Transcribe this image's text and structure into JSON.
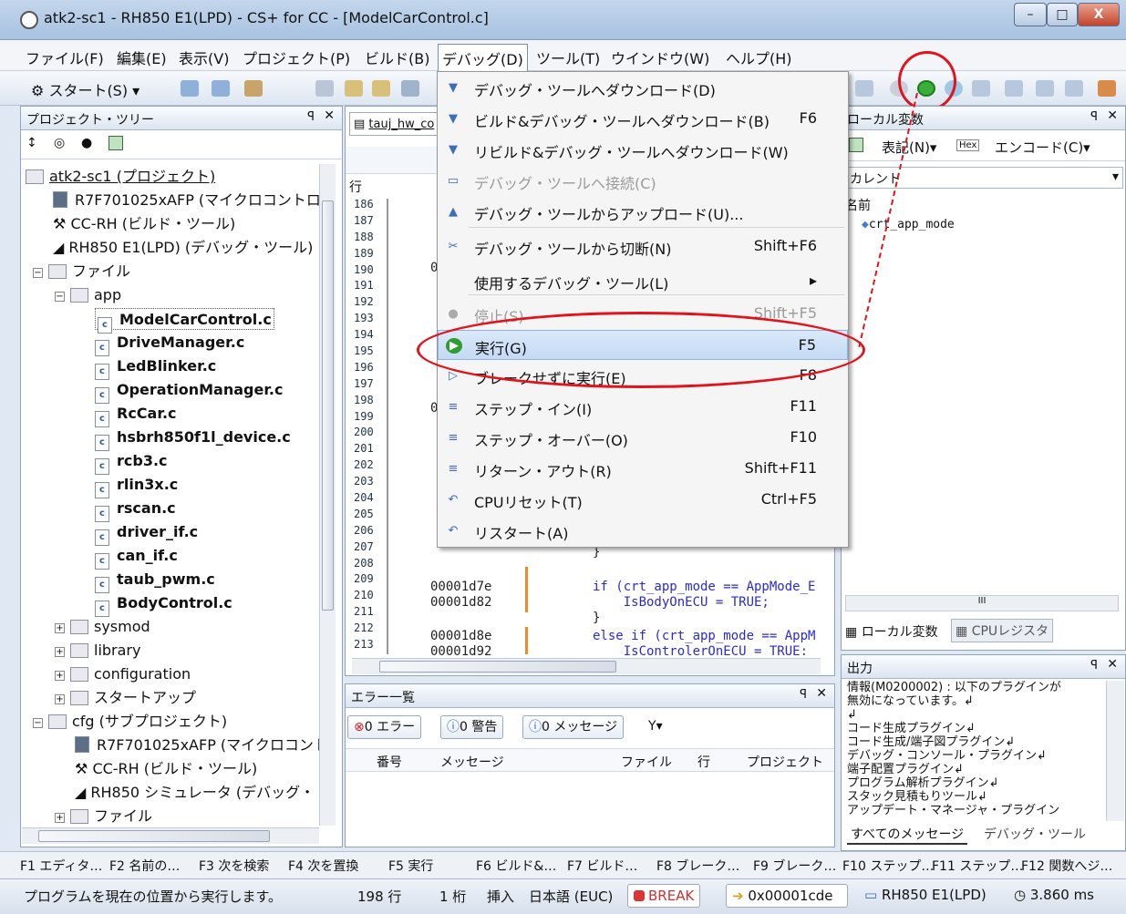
{
  "window": {
    "title": "atk2-sc1 - RH850 E1(LPD) - CS+ for CC - [ModelCarControl.c]",
    "min": "–",
    "max": "□",
    "close": "X"
  },
  "menubar": [
    "ファイル(F)",
    "編集(E)",
    "表示(V)",
    "プロジェクト(P)",
    "ビルド(B)",
    "デバッグ(D)",
    "ツール(T)",
    "ウインドウ(W)",
    "ヘルプ(H)"
  ],
  "toolbar": {
    "start": "スタート(S)"
  },
  "tree": {
    "title": "プロジェクト・ツリー",
    "pin": "ꟼ",
    "close": "✕",
    "project": "atk2-sc1 (プロジェクト)",
    "mcu": "R7F701025xAFP (マイクロコントロー",
    "build_tool": "CC-RH (ビルド・ツール)",
    "debug_tool": "RH850 E1(LPD) (デバッグ・ツール)",
    "files": "ファイル",
    "app": "app",
    "app_files": [
      "ModelCarControl.c",
      "DriveManager.c",
      "LedBlinker.c",
      "OperationManager.c",
      "RcCar.c",
      "hsbrh850f1l_device.c",
      "rcb3.c",
      "rlin3x.c",
      "rscan.c",
      "driver_if.c",
      "can_if.c",
      "taub_pwm.c",
      "BodyControl.c"
    ],
    "folders": [
      "sysmod",
      "library",
      "configuration",
      "スタートアップ"
    ],
    "cfg": "cfg (サブプロジェクト)",
    "cfg_mcu": "R7F701025xAFP (マイクロコント",
    "cfg_build": "CC-RH (ビルド・ツール)",
    "cfg_debug": "RH850 シミュレータ (デバッグ・",
    "cfg_files": "ファイル"
  },
  "editor": {
    "tab": "tauj_hw_co",
    "col_header": "行",
    "line_numbers": [
      "186",
      "187",
      "188",
      "189",
      "190",
      "191",
      "192",
      "193",
      "194",
      "195",
      "196",
      "197",
      "198",
      "199",
      "200",
      "201",
      "202",
      "203",
      "204",
      "205",
      "206",
      "207",
      "208",
      "209",
      "210",
      "211",
      "212",
      "213"
    ],
    "addr_190": "0",
    "addr_198": "0",
    "addresses": [
      "00001d7e",
      "00001d82",
      "00001d8e",
      "00001d92"
    ],
    "code": [
      "}",
      "if (crt_app_mode == AppMode_E",
      "    IsBodyOnECU = TRUE;",
      "}",
      "else if (crt_app_mode == AppM",
      "    IsControlerOnECU = TRUE;"
    ]
  },
  "debug_menu": [
    {
      "label": "デバッグ・ツールへダウンロード(D)",
      "sc": "",
      "dis": false
    },
    {
      "label": "ビルド&デバッグ・ツールへダウンロード(B)",
      "sc": "F6",
      "dis": false
    },
    {
      "label": "リビルド&デバッグ・ツールへダウンロード(W)",
      "sc": "",
      "dis": false
    },
    {
      "label": "デバッグ・ツールへ接続(C)",
      "sc": "",
      "dis": true
    },
    {
      "label": "デバッグ・ツールからアップロード(U)...",
      "sc": "",
      "dis": false
    },
    {
      "label": "デバッグ・ツールから切断(N)",
      "sc": "Shift+F6",
      "dis": false
    },
    {
      "label": "使用するデバッグ・ツール(L)",
      "sc": "▸",
      "dis": false
    },
    {
      "label": "停止(S)",
      "sc": "Shift+F5",
      "dis": true
    },
    {
      "label": "実行(G)",
      "sc": "F5",
      "dis": false
    },
    {
      "label": "ブレークせずに実行(E)",
      "sc": "F8",
      "dis": false
    },
    {
      "label": "ステップ・イン(I)",
      "sc": "F11",
      "dis": false
    },
    {
      "label": "ステップ・オーバー(O)",
      "sc": "F10",
      "dis": false
    },
    {
      "label": "リターン・アウト(R)",
      "sc": "Shift+F11",
      "dis": false
    },
    {
      "label": "CPUリセット(T)",
      "sc": "Ctrl+F5",
      "dis": false
    },
    {
      "label": "リスタート(A)",
      "sc": "",
      "dis": false
    }
  ],
  "locals": {
    "title": "ローカル変数",
    "notation": "表記(N)▾",
    "encode": "エンコード(C)▾",
    "scope": "カレント",
    "col_name": "名前",
    "var": "crt_app_mode",
    "tab_locals": "ローカル変数",
    "tab_cpu": "CPUレジスタ",
    "hscroll": "III"
  },
  "output": {
    "title": "出力",
    "lines": [
      "情報(M0200002) : 以下のプラグインが",
      "無効になっています。↲",
      "↲",
      "コード生成プラグイン↲",
      "コード生成/端子図プラグイン↲",
      "デバッグ・コンソール・プラグイン↲",
      "端子配置プラグイン↲",
      "プログラム解析プラグイン↲",
      "スタック見積もりツール↲",
      "アップデート・マネージャ・プラグイン"
    ],
    "tab_all": "すべてのメッセージ",
    "tab_debug": "デバッグ・ツール"
  },
  "errors": {
    "title": "エラー一覧",
    "err": "0 エラー",
    "warn": "0 警告",
    "msg": "0 メッセージ",
    "filter": "▾",
    "cols": [
      "番号",
      "メッセージ",
      "ファイル",
      "行",
      "プロジェクト"
    ]
  },
  "fkeys": [
    "F1 エディタ…",
    "F2 名前の…",
    "F3 次を検索",
    "F4 次を置換",
    "F5 実行",
    "F6 ビルド&…",
    "F7 ビルド…",
    "F8 ブレーク…",
    "F9 ブレーク…",
    "F10 ステップ…",
    "F11 ステップ…",
    "F12 関数へジ…"
  ],
  "status": {
    "message": "プログラムを現在の位置から実行します。",
    "line": "198 行",
    "col": "1 桁",
    "mode": "挿入",
    "enc": "日本語 (EUC)",
    "state": "BREAK",
    "pc": "0x00001cde",
    "tool": "RH850 E1(LPD)",
    "time": "3.860 ms"
  },
  "colors": {
    "highlight": "#c4daf5",
    "accent_red": "#e0141c",
    "run_green": "#2e9c2e"
  }
}
